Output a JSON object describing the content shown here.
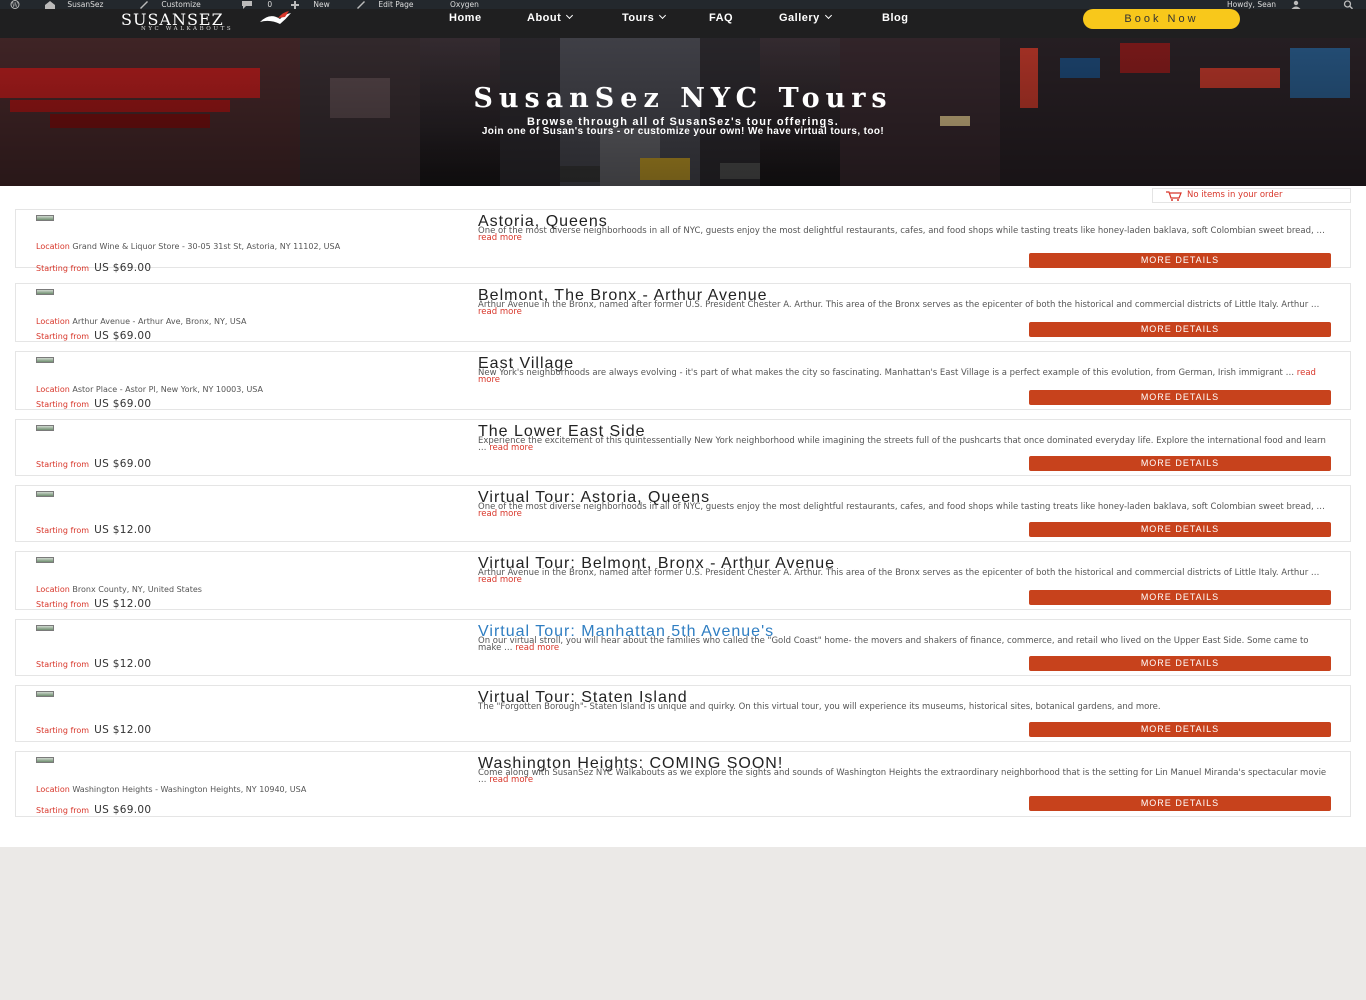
{
  "admin_bar": {
    "site_name": "SusanSez",
    "customize": "Customize",
    "comments_count": "0",
    "new": "New",
    "edit_page": "Edit Page",
    "oxygen": "Oxygen",
    "howdy": "Howdy, Sean"
  },
  "header": {
    "logo_main": "SUSANSEZ",
    "logo_sub": "NYC WALKABOUTS",
    "nav": [
      {
        "label": "Home",
        "has_dropdown": false
      },
      {
        "label": "About",
        "has_dropdown": true
      },
      {
        "label": "Tours",
        "has_dropdown": true
      },
      {
        "label": "FAQ",
        "has_dropdown": false
      },
      {
        "label": "Gallery",
        "has_dropdown": true
      },
      {
        "label": "Blog",
        "has_dropdown": false
      }
    ],
    "book_now": "Book Now"
  },
  "hero": {
    "title": "SusanSez NYC Tours",
    "subtitle_line1": "Browse through all of SusanSez's tour offerings.",
    "subtitle_line2": "Join one of Susan's tours - or customize your own! We have virtual tours, too!"
  },
  "order_status": "No items in your order",
  "labels": {
    "location": "Location",
    "starting_from": "Starting from",
    "more_details": "MORE DETAILS",
    "read_more": "read more"
  },
  "tours": [
    {
      "title": "Astoria, Queens",
      "description": "One of the most diverse neighborhoods in all of NYC, guests enjoy the most delightful restaurants, cafes, and food shops while tasting treats like honey-laden baklava, soft Colombian sweet bread, …",
      "location": "Grand Wine & Liquor Store - 30-05 31st St, Astoria, NY 11102, USA",
      "price": "US $69.00"
    },
    {
      "title": "Belmont, The Bronx - Arthur Avenue",
      "description": "Arthur Avenue in the Bronx, named after former U.S. President Chester A. Arthur. This area of the Bronx serves as the epicenter of both the historical and commercial districts of Little Italy. Arthur …",
      "location": "Arthur Avenue - Arthur Ave, Bronx, NY, USA",
      "price": "US $69.00"
    },
    {
      "title": "East Village",
      "description": "New York's neighborhoods are always evolving - it's part of what makes the city so fascinating. Manhattan's East Village is a perfect example of this evolution, from German, Irish immigrant …",
      "location": "Astor Place - Astor Pl, New York, NY 10003, USA",
      "price": "US $69.00"
    },
    {
      "title": "The Lower East Side",
      "description": "Experience the excitement of this quintessentially New York neighborhood while imagining the streets full of the pushcarts that once dominated everyday life. Explore the international food and learn …",
      "location": "",
      "price": "US $69.00"
    },
    {
      "title": "Virtual Tour: Astoria, Queens",
      "description": "One of the most diverse neighborhoods in all of NYC, guests enjoy the most delightful restaurants, cafes, and food shops while tasting treats like honey-laden baklava, soft Colombian sweet bread, …",
      "location": "",
      "price": "US $12.00"
    },
    {
      "title": "Virtual Tour: Belmont, Bronx - Arthur Avenue",
      "description": "Arthur Avenue in the Bronx, named after former U.S. President Chester A. Arthur. This area of the Bronx serves as the epicenter of both the historical and commercial districts of Little Italy. Arthur …",
      "location": "Bronx County, NY, United States",
      "price": "US $12.00"
    },
    {
      "title": "Virtual Tour: Manhattan 5th Avenue's",
      "description": "On our virtual stroll, you will hear about the families who called the \"Gold Coast\" home- the movers and shakers of finance, commerce, and retail who lived on the Upper East Side. Some came to make …",
      "location": "",
      "price": "US $12.00"
    },
    {
      "title": "Virtual Tour: Staten Island",
      "description": "The \"Forgotten Borough\"- Staten Island is unique and quirky. On this virtual tour, you will experience its museums, historical sites, botanical gardens, and more.",
      "location": "",
      "price": "US $12.00"
    },
    {
      "title": "Washington Heights: COMING SOON!",
      "description": "Come along with SusanSez NYC Walkabouts as we explore the sights and sounds of Washington Heights the extraordinary neighborhood that is the setting for Lin Manuel Miranda's spectacular movie …",
      "location": "Washington Heights - Washington Heights, NY 10940, USA",
      "price": "US $69.00"
    }
  ]
}
